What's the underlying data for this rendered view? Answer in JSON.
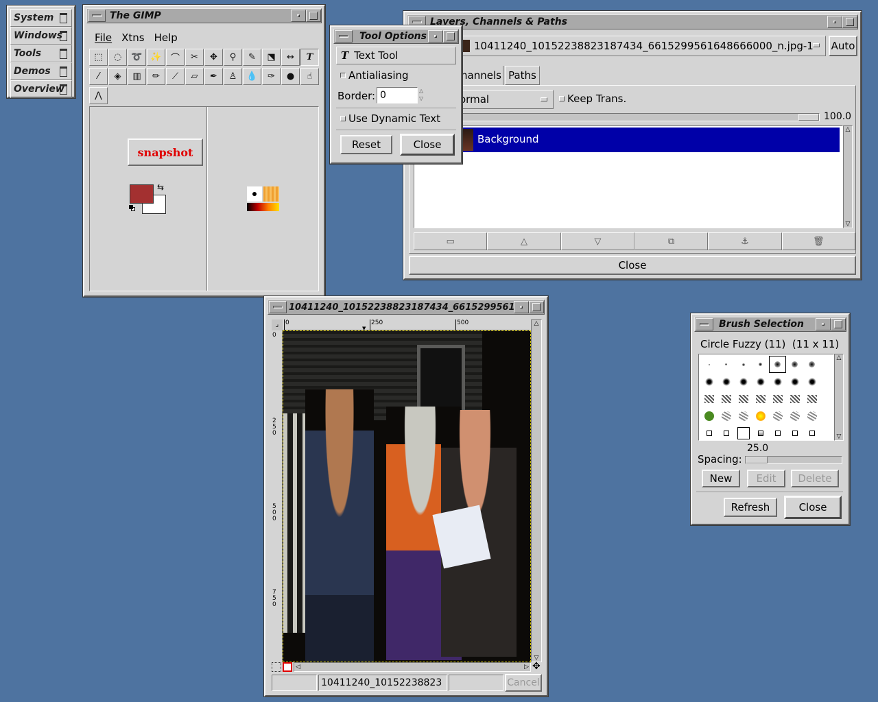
{
  "root_menu": {
    "items": [
      "System",
      "Windows",
      "Tools",
      "Demos",
      "Overview"
    ]
  },
  "gimp": {
    "title": "The GIMP",
    "menus": [
      "File",
      "Xtns",
      "Help"
    ],
    "snapshot_label": "snapshot",
    "fg_color": "#a33030",
    "bg_color": "#ffffff",
    "tools": [
      "rect-select-icon",
      "ellipse-select-icon",
      "free-select-icon",
      "fuzzy-select-icon",
      "bezier-select-icon",
      "scissors-icon",
      "move-icon",
      "zoom-icon",
      "crop-icon",
      "transform-icon",
      "flip-icon",
      "text-icon",
      "color-picker-icon",
      "bucket-fill-icon",
      "blend-icon",
      "pencil-icon",
      "paintbrush-icon",
      "eraser-icon",
      "airbrush-icon",
      "clone-icon",
      "convolve-icon",
      "ink-icon",
      "dodge-burn-icon",
      "smudge-icon",
      "measure-icon"
    ]
  },
  "tool_options": {
    "title": "Tool Options",
    "tool_name": "Text Tool",
    "antialiasing_label": "Antialiasing",
    "border_label": "Border:",
    "border_value": "0",
    "dynamic_text_label": "Use Dynamic Text",
    "reset_label": "Reset",
    "close_label": "Close"
  },
  "layers": {
    "title": "Layers, Channels & Paths",
    "image_name": "10411240_10152238823187434_6615299561648666000_n.jpg-1",
    "auto_label": "Auto",
    "tabs": [
      "hannels",
      "Paths"
    ],
    "mode": "ormal",
    "keep_trans_label": "Keep Trans.",
    "opacity": "100.0",
    "layer_name": "Background",
    "selection_color": "#0000a8",
    "close_label": "Close",
    "actions": [
      "new-layer-icon",
      "raise-layer-icon",
      "lower-layer-icon",
      "duplicate-layer-icon",
      "anchor-icon",
      "trash-icon"
    ]
  },
  "image_window": {
    "title": "10411240_10152238823187434_6615299561648",
    "ruler_h": [
      "0",
      "250",
      "500"
    ],
    "ruler_v": [
      "0",
      "2\n5\n0",
      "5\n0\n0",
      "7\n5\n0"
    ],
    "status_text": "10411240_10152238823",
    "cancel_label": "Cancel"
  },
  "brush": {
    "title": "Brush Selection",
    "brush_name": "Circle Fuzzy (11)  (11 x 11)",
    "spacing_value": "25.0",
    "spacing_label": "Spacing:",
    "spacing_fraction": 0.25,
    "new_label": "New",
    "edit_label": "Edit",
    "delete_label": "Delete",
    "refresh_label": "Refresh",
    "close_label": "Close"
  }
}
